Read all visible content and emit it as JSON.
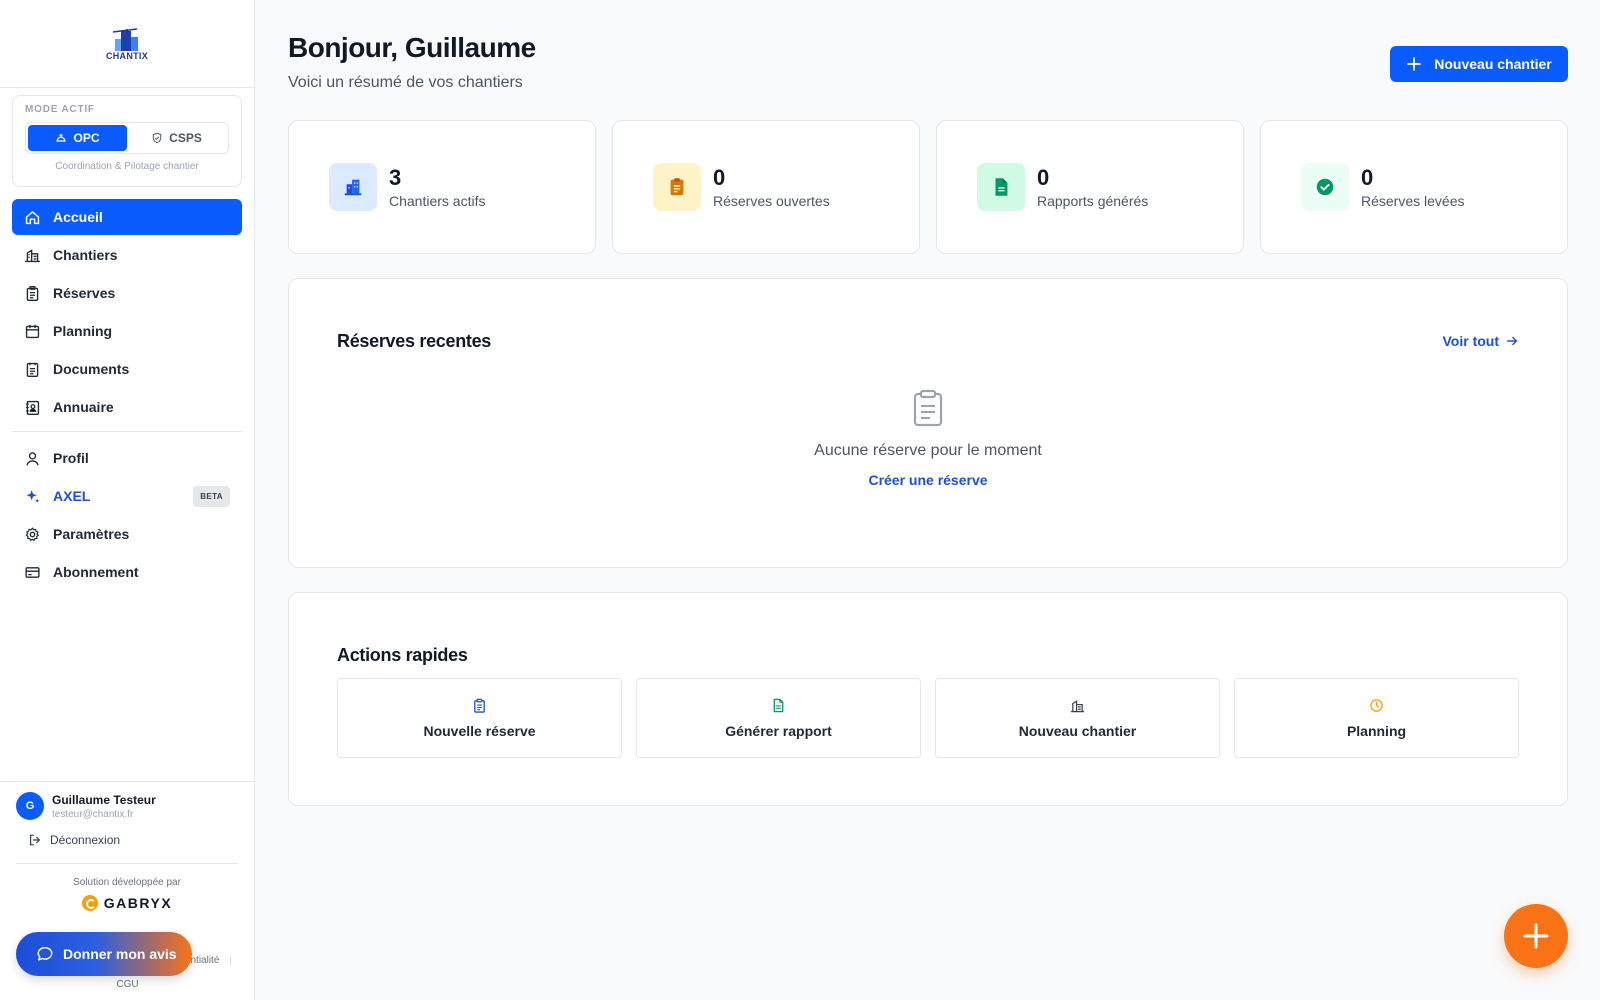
{
  "app": {
    "logo_text": "CHANTIX"
  },
  "sidebar": {
    "mode": {
      "label": "MODE ACTIF",
      "options": [
        "OPC",
        "CSPS"
      ],
      "selected": "OPC",
      "description": "Coordination & Pilotage chantier"
    },
    "nav": [
      {
        "label": "Accueil",
        "icon": "home-icon",
        "active": true
      },
      {
        "label": "Chantiers",
        "icon": "building-icon"
      },
      {
        "label": "Réserves",
        "icon": "clipboard-icon"
      },
      {
        "label": "Planning",
        "icon": "calendar-icon"
      },
      {
        "label": "Documents",
        "icon": "document-icon"
      },
      {
        "label": "Annuaire",
        "icon": "contacts-icon"
      }
    ],
    "nav_secondary": [
      {
        "label": "Profil",
        "icon": "user-icon"
      },
      {
        "label": "AXEL",
        "icon": "sparkle-icon",
        "badge": "BETA"
      },
      {
        "label": "Paramètres",
        "icon": "gear-icon"
      },
      {
        "label": "Abonnement",
        "icon": "credit-card-icon"
      }
    ],
    "user": {
      "initial": "G",
      "name": "Guillaume Testeur",
      "email": "testeur@chantix.fr"
    },
    "logout_label": "Déconnexion",
    "developed_by": "Solution développée par",
    "developer": "GABRYX",
    "legal_partial": "ntialité",
    "cgu": "CGU",
    "feedback_label": "Donner mon avis"
  },
  "header": {
    "greeting": "Bonjour, Guillaume",
    "subtitle": "Voici un résumé de vos chantiers",
    "new_button": "Nouveau chantier"
  },
  "stats": [
    {
      "value": "3",
      "label": "Chantiers actifs",
      "icon": "building-icon",
      "color": "#1d4ed8",
      "bg": "#dbeafe"
    },
    {
      "value": "0",
      "label": "Réserves ouvertes",
      "icon": "clipboard-icon",
      "color": "#d97706",
      "bg": "#fef3c7"
    },
    {
      "value": "0",
      "label": "Rapports générés",
      "icon": "document-icon",
      "color": "#059669",
      "bg": "#d1fae5"
    },
    {
      "value": "0",
      "label": "Réserves levées",
      "icon": "check-circle-icon",
      "color": "#059669",
      "bg": "#ecfdf5"
    }
  ],
  "recent": {
    "title": "Réserves recentes",
    "view_all": "Voir tout",
    "empty_text": "Aucune réserve pour le moment",
    "create_link": "Créer une réserve"
  },
  "quick_actions": {
    "title": "Actions rapides",
    "items": [
      {
        "label": "Nouvelle réserve",
        "icon": "clipboard-icon",
        "color": "#1d4ed8"
      },
      {
        "label": "Générer rapport",
        "icon": "document-icon",
        "color": "#059669"
      },
      {
        "label": "Nouveau chantier",
        "icon": "building-icon",
        "color": "#374151"
      },
      {
        "label": "Planning",
        "icon": "clock-icon",
        "color": "#f59e0b"
      }
    ]
  },
  "colors": {
    "primary": "#0b5cff",
    "accent": "#f97316"
  }
}
